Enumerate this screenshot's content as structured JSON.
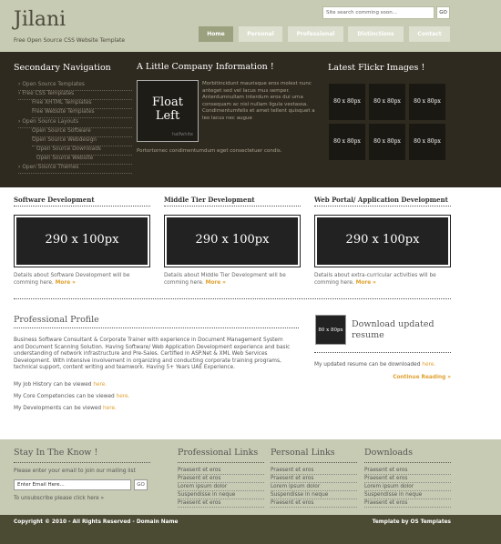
{
  "header": {
    "logo": "Jilani",
    "tagline": "Free Open Source CSS Website Template",
    "search_placeholder": "Site search comming soon...",
    "search_button": "GO",
    "nav": [
      "Home",
      "Personal",
      "Professional",
      "Distinctions",
      "Contact"
    ],
    "active_nav": "Home"
  },
  "band": {
    "secondary_title": "Secondary Navigation",
    "secondary_items": [
      "Open Source Templates",
      "Free CSS Templates",
      "Free XHTML Templates",
      "Free Website Templates",
      "Open Source Layouts",
      "Open Source Software",
      "Open Source Webdesign",
      "Open Source Downloads",
      "Open Source Website",
      "Open Source Themes"
    ],
    "info_title": "A Little Company Information !",
    "float_text_1": "Float",
    "float_text_2": "Left",
    "float_sub": "halfwhite",
    "info_text": "Morbitincidunt maurisque eros molest nunc anteget sed vel lacus mus semper. Anterdumnullam interdum eros dui urna consequam ac nisl nullam ligula vestassa. Condimentumfelis et amet tellent quisquet a leo lacus nec augue",
    "info_text_2": "Portortornec condimentumdum eget consectetuer condis.",
    "flickr_title": "Latest Flickr Images !",
    "flickr_label": "80 x 80px"
  },
  "columns": [
    {
      "title": "Software Development",
      "placeholder": "290 x 100px",
      "text": "Details about Software Development will be comming here.",
      "more": "More »"
    },
    {
      "title": "Middle Tier Development",
      "placeholder": "290 x 100px",
      "text": "Details about Middle Tier Development will be comming here.",
      "more": "More »"
    },
    {
      "title": "Web Portal/ Application Development",
      "placeholder": "290 x 100px",
      "text": "Details about extra-curricular activities will be comming here.",
      "more": "More »"
    }
  ],
  "profile": {
    "title": "Professional Profile",
    "body": "Business Software Consultant & Corporate Trainer with experience in Document Management System and Document Scanning Solution. Having Software/ Web Application Development experience and basic understanding of network infrastructure and Pre-Sales. Certified in ASP.Net & XML Web Services Development. With intensive involvement in organizing and conducting corporate training programs, technical support, content writing and teamwork. Having 5+ Years UAE Experience.",
    "job_history": "My Job History can be viewed",
    "competencies": "My Core Competencies can be viewed",
    "developments": "My Developments can be viewed",
    "here": "here."
  },
  "download": {
    "thumb": "80 x 80px",
    "title": "Download updated resume",
    "text": "My updated resume can be downloaded",
    "here": "here.",
    "continue": "Continue Reading »"
  },
  "footer": {
    "stay_title": "Stay In The Know !",
    "stay_text": "Please enter your email to join our mailing list",
    "email_value": "Enter Email Here...",
    "email_button": "GO",
    "unsubscribe": "To unsubscribe please click here »",
    "prof_links_title": "Professional Links",
    "prof_links": [
      "Praesent et eros",
      "Praesent et eros",
      "Lorem ipsum dolor",
      "Suspendisse in neque",
      "Praesent et eros"
    ],
    "personal_links_title": "Personal Links",
    "personal_links": [
      "Praesent et eros",
      "Praesent et eros",
      "Lorem ipsum dolor",
      "Suspendisse in neque",
      "Praesent et eros"
    ],
    "downloads_title": "Downloads",
    "downloads": [
      "Praesent et eros",
      "Praesent et eros",
      "Lorem ipsum dolor",
      "Suspendisse in neque",
      "Praesent et eros"
    ],
    "copyright": "Copyright © 2010 - All Rights Reserved - Domain Name",
    "credit": "Template by OS Templates"
  }
}
